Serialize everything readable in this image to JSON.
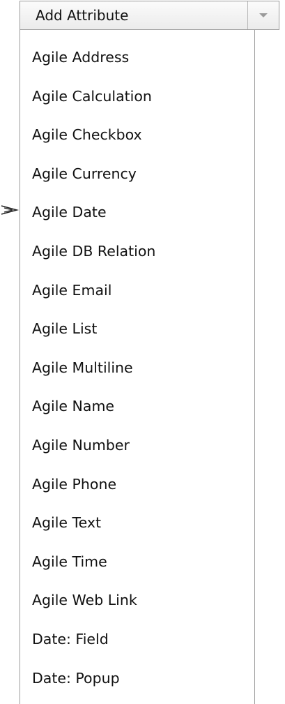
{
  "dropdown": {
    "label": "Add Attribute",
    "arrow_icon": "chevron-down-icon"
  },
  "pointer_icon": "arrow-pointer-icon",
  "menu": {
    "items": [
      {
        "label": "Agile Address"
      },
      {
        "label": "Agile Calculation"
      },
      {
        "label": "Agile Checkbox"
      },
      {
        "label": "Agile Currency"
      },
      {
        "label": "Agile Date"
      },
      {
        "label": "Agile DB Relation"
      },
      {
        "label": "Agile Email"
      },
      {
        "label": "Agile List"
      },
      {
        "label": "Agile Multiline"
      },
      {
        "label": "Agile Name"
      },
      {
        "label": "Agile Number"
      },
      {
        "label": "Agile Phone"
      },
      {
        "label": "Agile Text"
      },
      {
        "label": "Agile Time"
      },
      {
        "label": "Agile Web Link"
      },
      {
        "label": "Date: Field"
      },
      {
        "label": "Date: Popup"
      }
    ]
  }
}
